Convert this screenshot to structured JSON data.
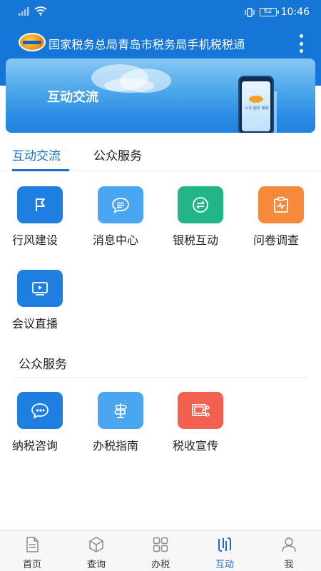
{
  "status_bar": {
    "time": "10:46",
    "battery": "62"
  },
  "header": {
    "title": "国家税务总局青岛市税务局手机税税通"
  },
  "banner": {
    "title": "互动交流",
    "phone_text": "公共 服务 微服"
  },
  "tabs": [
    {
      "label": "互动交流",
      "active": true
    },
    {
      "label": "公众服务",
      "active": false
    }
  ],
  "interaction_items": [
    {
      "label": "行风建设",
      "icon": "flag-icon",
      "color": "#1f7fe0"
    },
    {
      "label": "消息中心",
      "icon": "message-icon",
      "color": "#4ba6f2"
    },
    {
      "label": "银税互动",
      "icon": "exchange-icon",
      "color": "#22b58a"
    },
    {
      "label": "问卷调查",
      "icon": "clipboard-icon",
      "color": "#f58a3a"
    },
    {
      "label": "会议直播",
      "icon": "video-icon",
      "color": "#1f7fe0"
    }
  ],
  "public_section": {
    "title": "公众服务"
  },
  "public_items": [
    {
      "label": "纳税咨询",
      "icon": "chat-quote-icon",
      "color": "#1f7fe0"
    },
    {
      "label": "办税指南",
      "icon": "signpost-icon",
      "color": "#4ba6f2"
    },
    {
      "label": "税收宣传",
      "icon": "share-screen-icon",
      "color": "#f2614f"
    }
  ],
  "bottom_nav": [
    {
      "label": "首页",
      "icon": "home-doc-icon",
      "active": false
    },
    {
      "label": "查询",
      "icon": "box-icon",
      "active": false
    },
    {
      "label": "办税",
      "icon": "grid-icon",
      "active": false
    },
    {
      "label": "互动",
      "icon": "interaction-icon",
      "active": true
    },
    {
      "label": "我",
      "icon": "user-icon",
      "active": false
    }
  ]
}
